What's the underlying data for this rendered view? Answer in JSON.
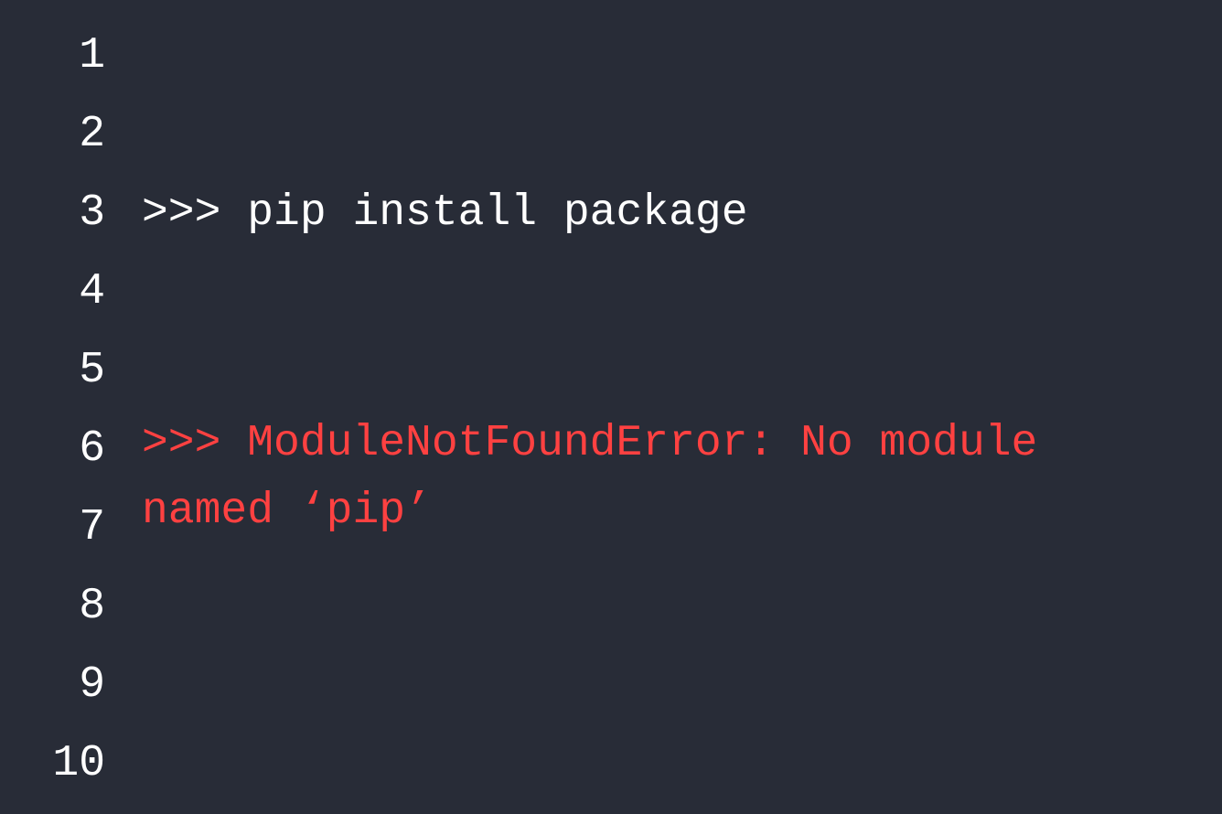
{
  "editor": {
    "line_numbers": [
      "1",
      "2",
      "3",
      "4",
      "5",
      "6",
      "7",
      "8",
      "9",
      "10"
    ],
    "lines": {
      "l3": ">>> pip install package"
    },
    "error_text": ">>> ModuleNotFoundError: No module named ‘pip’"
  },
  "colors": {
    "background": "#282c37",
    "foreground": "#ffffff",
    "error": "#ff4141"
  }
}
